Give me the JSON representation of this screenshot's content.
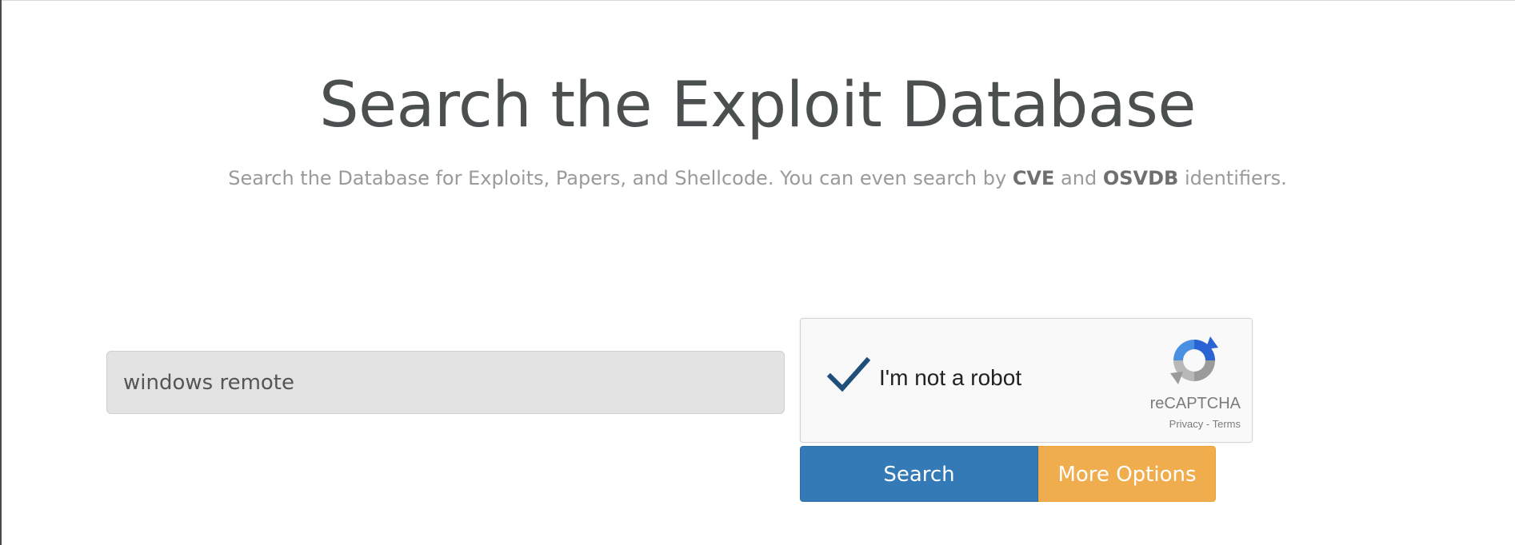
{
  "header": {
    "title": "Search the Exploit Database",
    "subtitle_start": "Search the Database for Exploits, Papers, and Shellcode. You can even search by ",
    "subtitle_cve": "CVE",
    "subtitle_and": " and ",
    "subtitle_osvdb": "OSVDB",
    "subtitle_end": " identifiers."
  },
  "search": {
    "value": "windows remote"
  },
  "captcha": {
    "label": "I'm not a robot",
    "brand": "reCAPTCHA",
    "links": "Privacy - Terms",
    "checked": true
  },
  "actions": {
    "search_label": "Search",
    "more_options_label": "More Options"
  },
  "colors": {
    "search_button": "#337ab7",
    "more_options_button": "#f0ad4e",
    "checkmark": "#1f4e79"
  }
}
